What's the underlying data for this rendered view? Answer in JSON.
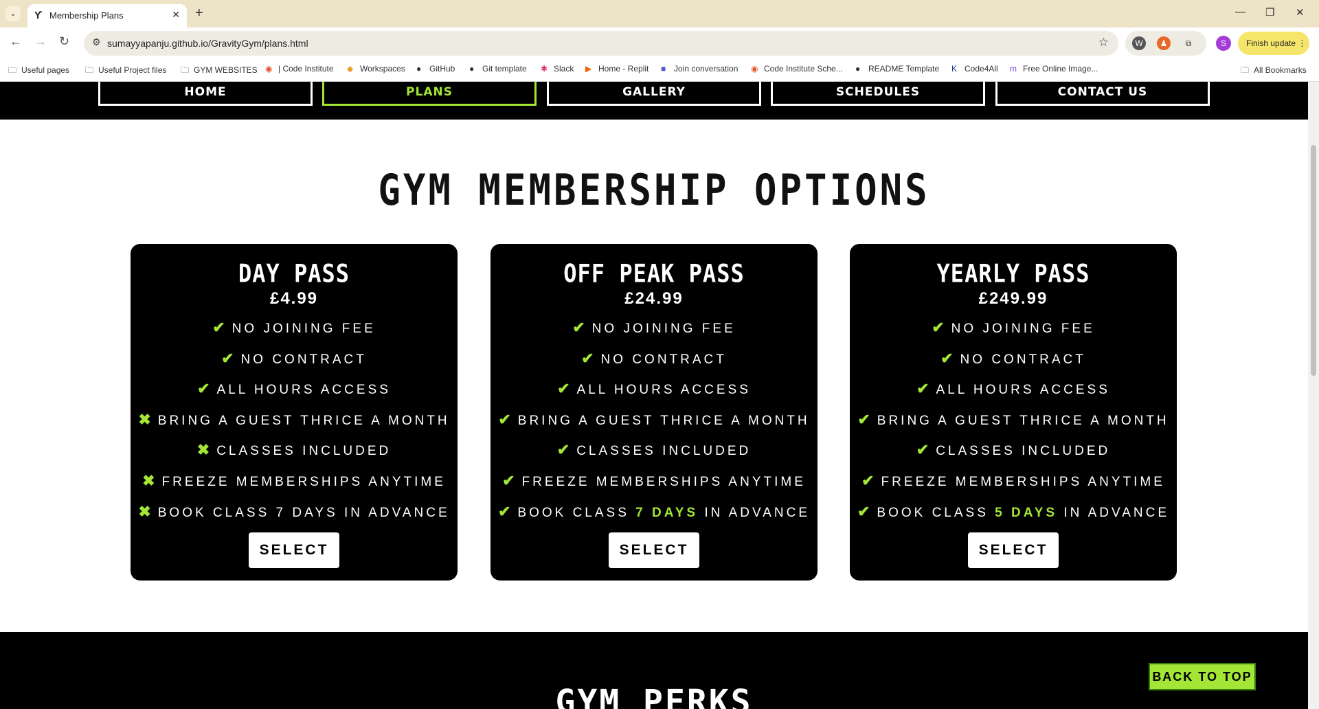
{
  "browser": {
    "tab_title": "Membership Plans",
    "tab_favicon": "barbell-icon",
    "url": "sumayyapanju.github.io/GravityGym/plans.html",
    "profile_initial": "S",
    "finish_update_label": "Finish update",
    "bookmarks": [
      {
        "label": "Useful pages",
        "icon": "folder-icon"
      },
      {
        "label": "Useful Project files",
        "icon": "folder-icon"
      },
      {
        "label": "GYM WEBSITES",
        "icon": "folder-icon"
      },
      {
        "label": "| Code Institute",
        "icon": "code-institute-icon"
      },
      {
        "label": "Workspaces",
        "icon": "gitpod-icon"
      },
      {
        "label": "GitHub",
        "icon": "github-icon"
      },
      {
        "label": "Git template",
        "icon": "github-icon"
      },
      {
        "label": "Slack",
        "icon": "slack-icon"
      },
      {
        "label": "Home - Replit",
        "icon": "replit-icon"
      },
      {
        "label": "Join conversation",
        "icon": "teams-icon"
      },
      {
        "label": "Code Institute Sche...",
        "icon": "code-institute-icon"
      },
      {
        "label": "README Template",
        "icon": "github-icon"
      },
      {
        "label": "Code4All",
        "icon": "code4all-icon"
      },
      {
        "label": "Free Online Image...",
        "icon": "image-tool-icon"
      }
    ],
    "all_bookmarks_label": "All Bookmarks"
  },
  "site_nav": [
    {
      "label": "HOME",
      "active": false
    },
    {
      "label": "PLANS",
      "active": true
    },
    {
      "label": "GALLERY",
      "active": false
    },
    {
      "label": "SCHEDULES",
      "active": false
    },
    {
      "label": "CONTACT US",
      "active": false
    }
  ],
  "heading": "GYM MEMBERSHIP OPTIONS",
  "plans": [
    {
      "name": "DAY PASS",
      "price": "£4.99",
      "features": [
        {
          "text": "NO JOINING FEE",
          "included": true
        },
        {
          "text": "NO CONTRACT",
          "included": true
        },
        {
          "text": "ALL HOURS ACCESS",
          "included": true
        },
        {
          "text": "BRING A GUEST THRICE A MONTH",
          "included": false
        },
        {
          "text": "CLASSES INCLUDED",
          "included": false
        },
        {
          "text": "FREEZE MEMBERSHIPS ANYTIME",
          "included": false
        },
        {
          "text_before": "BOOK CLASS ",
          "highlight": "7 DAYS",
          "text_after": " IN ADVANCE",
          "included": false,
          "highlighted": false
        }
      ],
      "button": "SELECT"
    },
    {
      "name": "OFF PEAK PASS",
      "price": "£24.99",
      "features": [
        {
          "text": "NO JOINING FEE",
          "included": true
        },
        {
          "text": "NO CONTRACT",
          "included": true
        },
        {
          "text": "ALL HOURS ACCESS",
          "included": true
        },
        {
          "text": "BRING A GUEST THRICE A MONTH",
          "included": true
        },
        {
          "text": "CLASSES INCLUDED",
          "included": true
        },
        {
          "text": "FREEZE MEMBERSHIPS ANYTIME",
          "included": true
        },
        {
          "text_before": "BOOK CLASS ",
          "highlight": "7 DAYS",
          "text_after": " IN ADVANCE",
          "included": true,
          "highlighted": true
        }
      ],
      "button": "SELECT"
    },
    {
      "name": "YEARLY PASS",
      "price": "£249.99",
      "features": [
        {
          "text": "NO JOINING FEE",
          "included": true
        },
        {
          "text": "NO CONTRACT",
          "included": true
        },
        {
          "text": "ALL HOURS ACCESS",
          "included": true
        },
        {
          "text": "BRING A GUEST THRICE A MONTH",
          "included": true
        },
        {
          "text": "CLASSES INCLUDED",
          "included": true
        },
        {
          "text": "FREEZE MEMBERSHIPS ANYTIME",
          "included": true
        },
        {
          "text_before": "BOOK CLASS ",
          "highlight": "5 DAYS",
          "text_after": " IN ADVANCE",
          "included": true,
          "highlighted": true
        }
      ],
      "button": "SELECT"
    }
  ],
  "perks_heading": "GYM PERKS",
  "back_to_top": "BACK TO TOP",
  "colors": {
    "accent": "#a3e635",
    "card_bg": "#000000",
    "page_bg": "#ffffff"
  }
}
